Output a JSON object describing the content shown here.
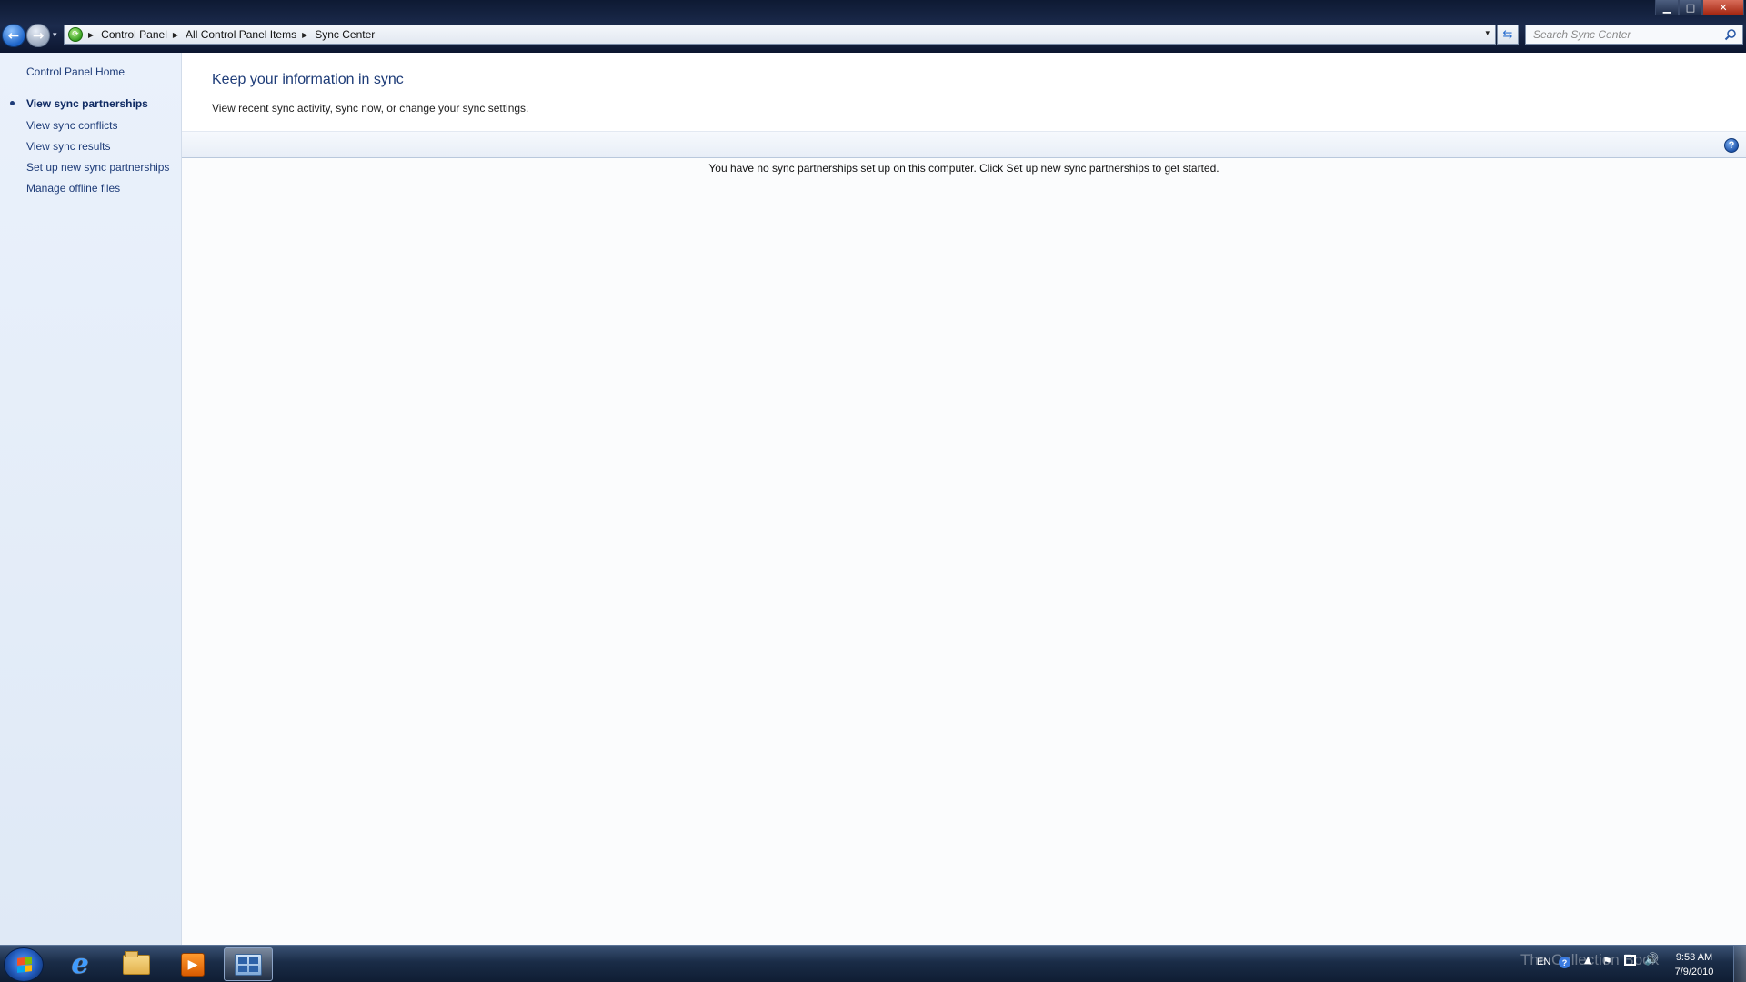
{
  "window": {
    "controls": {
      "minimize": "▁",
      "maximize": "□",
      "close": "✕"
    }
  },
  "navigation": {
    "back_icon": "←",
    "forward_icon": "→",
    "recent_icon": "▾",
    "address_icon": "⟳",
    "breadcrumb_sep": "▶",
    "breadcrumbs": [
      "Control Panel",
      "All Control Panel Items",
      "Sync Center"
    ],
    "address_dropdown_icon": "▾",
    "refresh_icon": "⇆"
  },
  "search": {
    "placeholder": "Search Sync Center"
  },
  "sidebar": {
    "home_link": "Control Panel Home",
    "items": [
      {
        "label": "View sync partnerships",
        "current": true
      },
      {
        "label": "View sync conflicts"
      },
      {
        "label": "View sync results"
      },
      {
        "label": "Set up new sync partnerships"
      },
      {
        "label": "Manage offline files"
      }
    ]
  },
  "main": {
    "title": "Keep your information in sync",
    "description": "View recent sync activity, sync now, or change your sync settings.",
    "help_icon": "?",
    "empty_message": "You have no sync partnerships set up on this computer. Click Set up new sync partnerships to get started."
  },
  "taskbar": {
    "pinned": [
      "internet-explorer",
      "windows-explorer",
      "windows-media-player",
      "control-panel"
    ],
    "ie_glyph": "e",
    "media_glyph": "▶",
    "tray": {
      "language": "EN",
      "help_glyph": "?",
      "arrow_glyph": "▲",
      "flag_glyph": "⚑",
      "volume_glyph": "🔊",
      "watermark": "The Collection Book"
    },
    "clock": {
      "time": "9:53 AM",
      "date": "7/9/2010"
    }
  }
}
